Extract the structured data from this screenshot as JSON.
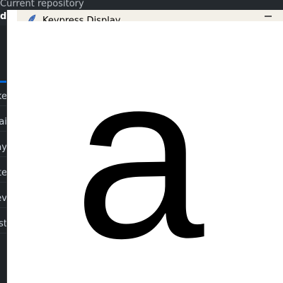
{
  "background_app": {
    "repo_label": "Current repository",
    "repo_name": "dla",
    "sidebar_items": [
      "ke",
      "ai",
      "ay",
      "te",
      "ev",
      "st"
    ],
    "accent_color": "#0366d6"
  },
  "keypress_window": {
    "title": "Keypress Display",
    "icon": "feather-icon",
    "key": "a"
  }
}
